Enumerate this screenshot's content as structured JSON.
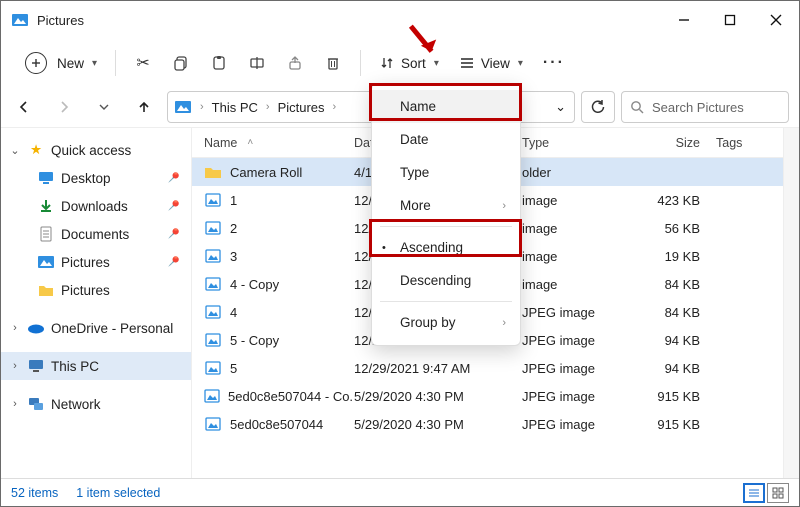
{
  "window": {
    "title": "Pictures"
  },
  "toolbar": {
    "new_label": "New",
    "sort_label": "Sort",
    "view_label": "View"
  },
  "breadcrumb": {
    "root": "This PC",
    "folder": "Pictures"
  },
  "search": {
    "placeholder": "Search Pictures"
  },
  "sidebar": {
    "quick_access": "Quick access",
    "desktop": "Desktop",
    "downloads": "Downloads",
    "documents": "Documents",
    "pictures_a": "Pictures",
    "pictures_b": "Pictures",
    "onedrive": "OneDrive - Personal",
    "this_pc": "This PC",
    "network": "Network"
  },
  "columns": {
    "name": "Name",
    "date": "Date",
    "type": "Type",
    "size": "Size",
    "tags": "Tags"
  },
  "rows": [
    {
      "name": "Camera Roll",
      "date": "4/19/20",
      "type": "older",
      "size": "",
      "kind": "folder",
      "selected": true
    },
    {
      "name": "1",
      "date": "12/29/2",
      "type": "image",
      "size": "423 KB",
      "kind": "img"
    },
    {
      "name": "2",
      "date": "12/29/2",
      "type": "image",
      "size": "56 KB",
      "kind": "img"
    },
    {
      "name": "3",
      "date": "12/29/2",
      "type": "image",
      "size": "19 KB",
      "kind": "img"
    },
    {
      "name": "4 - Copy",
      "date": "12/29/2",
      "type": "image",
      "size": "84 KB",
      "kind": "img"
    },
    {
      "name": "4",
      "date": "12/29/2021 9:47 AM",
      "type": "JPEG image",
      "size": "84 KB",
      "kind": "img"
    },
    {
      "name": "5 - Copy",
      "date": "12/29/2021 9:47 AM",
      "type": "JPEG image",
      "size": "94 KB",
      "kind": "img"
    },
    {
      "name": "5",
      "date": "12/29/2021 9:47 AM",
      "type": "JPEG image",
      "size": "94 KB",
      "kind": "img"
    },
    {
      "name": "5ed0c8e507044 - Co...",
      "date": "5/29/2020 4:30 PM",
      "type": "JPEG image",
      "size": "915 KB",
      "kind": "img"
    },
    {
      "name": "5ed0c8e507044",
      "date": "5/29/2020 4:30 PM",
      "type": "JPEG image",
      "size": "915 KB",
      "kind": "img"
    }
  ],
  "sort_menu": {
    "name": "Name",
    "date": "Date",
    "type": "Type",
    "more": "More",
    "ascending": "Ascending",
    "descending": "Descending",
    "group_by": "Group by"
  },
  "status": {
    "count": "52 items",
    "selected": "1 item selected"
  }
}
